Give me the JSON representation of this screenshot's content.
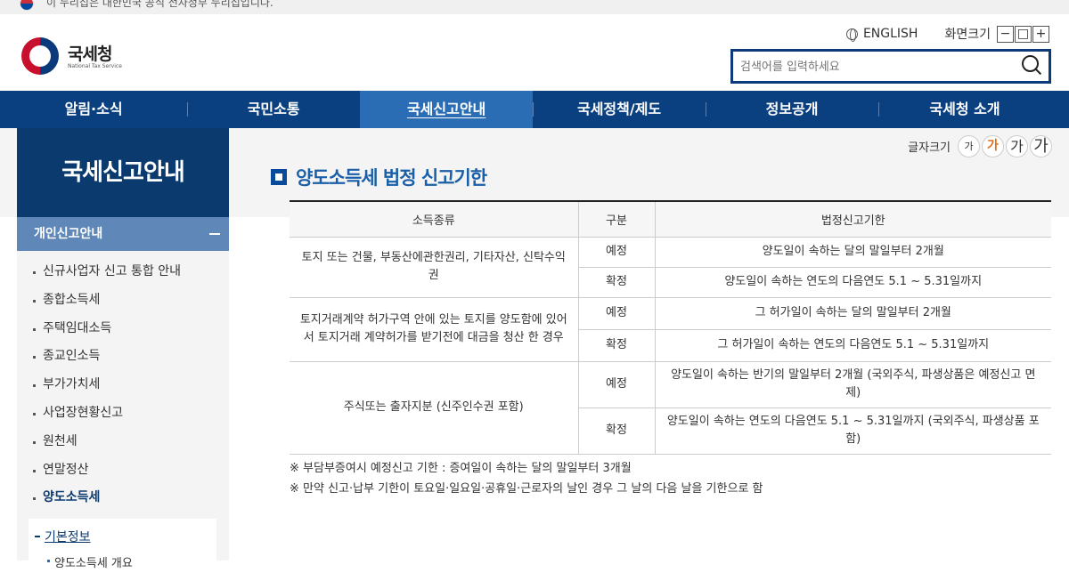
{
  "gov_banner": {
    "text": "이 누리집은 대한민국 공식 전자정부 누리집입니다."
  },
  "header": {
    "logo_name": "국세청",
    "logo_sub": "National Tax Service",
    "lang_label": "ENGLISH",
    "zoom_label": "화면크기",
    "zoom_buttons": [
      "−",
      "□",
      "+"
    ],
    "search_placeholder": "검색어를 입력하세요"
  },
  "gnb": {
    "items": [
      "알림·소식",
      "국민소통",
      "국세신고안내",
      "국세정책/제도",
      "정보공개",
      "국세청 소개"
    ],
    "active_index": 2
  },
  "lnb": {
    "title": "국세신고안내",
    "category": "개인신고안내",
    "menu": [
      "신규사업자 신고 통합 안내",
      "종합소득세",
      "주택임대소득",
      "종교인소득",
      "부가가치세",
      "사업장현황신고",
      "원천세",
      "연말정산",
      "양도소득세"
    ],
    "active_menu_index": 8,
    "sub_active": "기본정보",
    "sub_item": "양도소득세 개요"
  },
  "fontsize": {
    "label": "글자크기",
    "buttons": [
      "가",
      "가",
      "가",
      "가"
    ]
  },
  "content": {
    "title": "양도소득세 법정 신고기한",
    "table": {
      "headers": [
        "소득종류",
        "구분",
        "법정신고기한"
      ],
      "groups": [
        {
          "type": "토지 또는 건물, 부동산에관한권리, 기타자산, 신탁수익권",
          "rows": [
            {
              "kind": "예정",
              "deadline": "양도일이 속하는 달의 말일부터 2개월"
            },
            {
              "kind": "확정",
              "deadline": "양도일이 속하는 연도의 다음연도 5.1 ~ 5.31일까지"
            }
          ]
        },
        {
          "type": "토지거래계약 허가구역 안에 있는 토지를 양도함에 있어서 토지거래 계약허가를 받기전에 대금을 청산 한 경우",
          "rows": [
            {
              "kind": "예정",
              "deadline": "그 허가일이 속하는 달의 말일부터 2개월"
            },
            {
              "kind": "확정",
              "deadline": "그 허가일이 속하는 연도의 다음연도 5.1 ~ 5.31일까지"
            }
          ]
        },
        {
          "type": "주식또는 출자지분 (신주인수권 포함)",
          "rows": [
            {
              "kind": "예정",
              "deadline": "양도일이 속하는 반기의 말일부터 2개월 (국외주식, 파생상품은 예정신고 면제)"
            },
            {
              "kind": "확정",
              "deadline": "양도일이 속하는 연도의 다음연도 5.1 ~ 5.31일까지 (국외주식, 파생상품 포함)"
            }
          ]
        }
      ]
    },
    "notes": [
      "※ 부담부증여시 예정신고 기한 : 증여일이 속하는 달의 말일부터 3개월",
      "※ 만약 신고·납부 기한이 토요일·일요일·공휴일·근로자의 날인 경우 그 날의 다음 날을 기한으로 함"
    ]
  }
}
